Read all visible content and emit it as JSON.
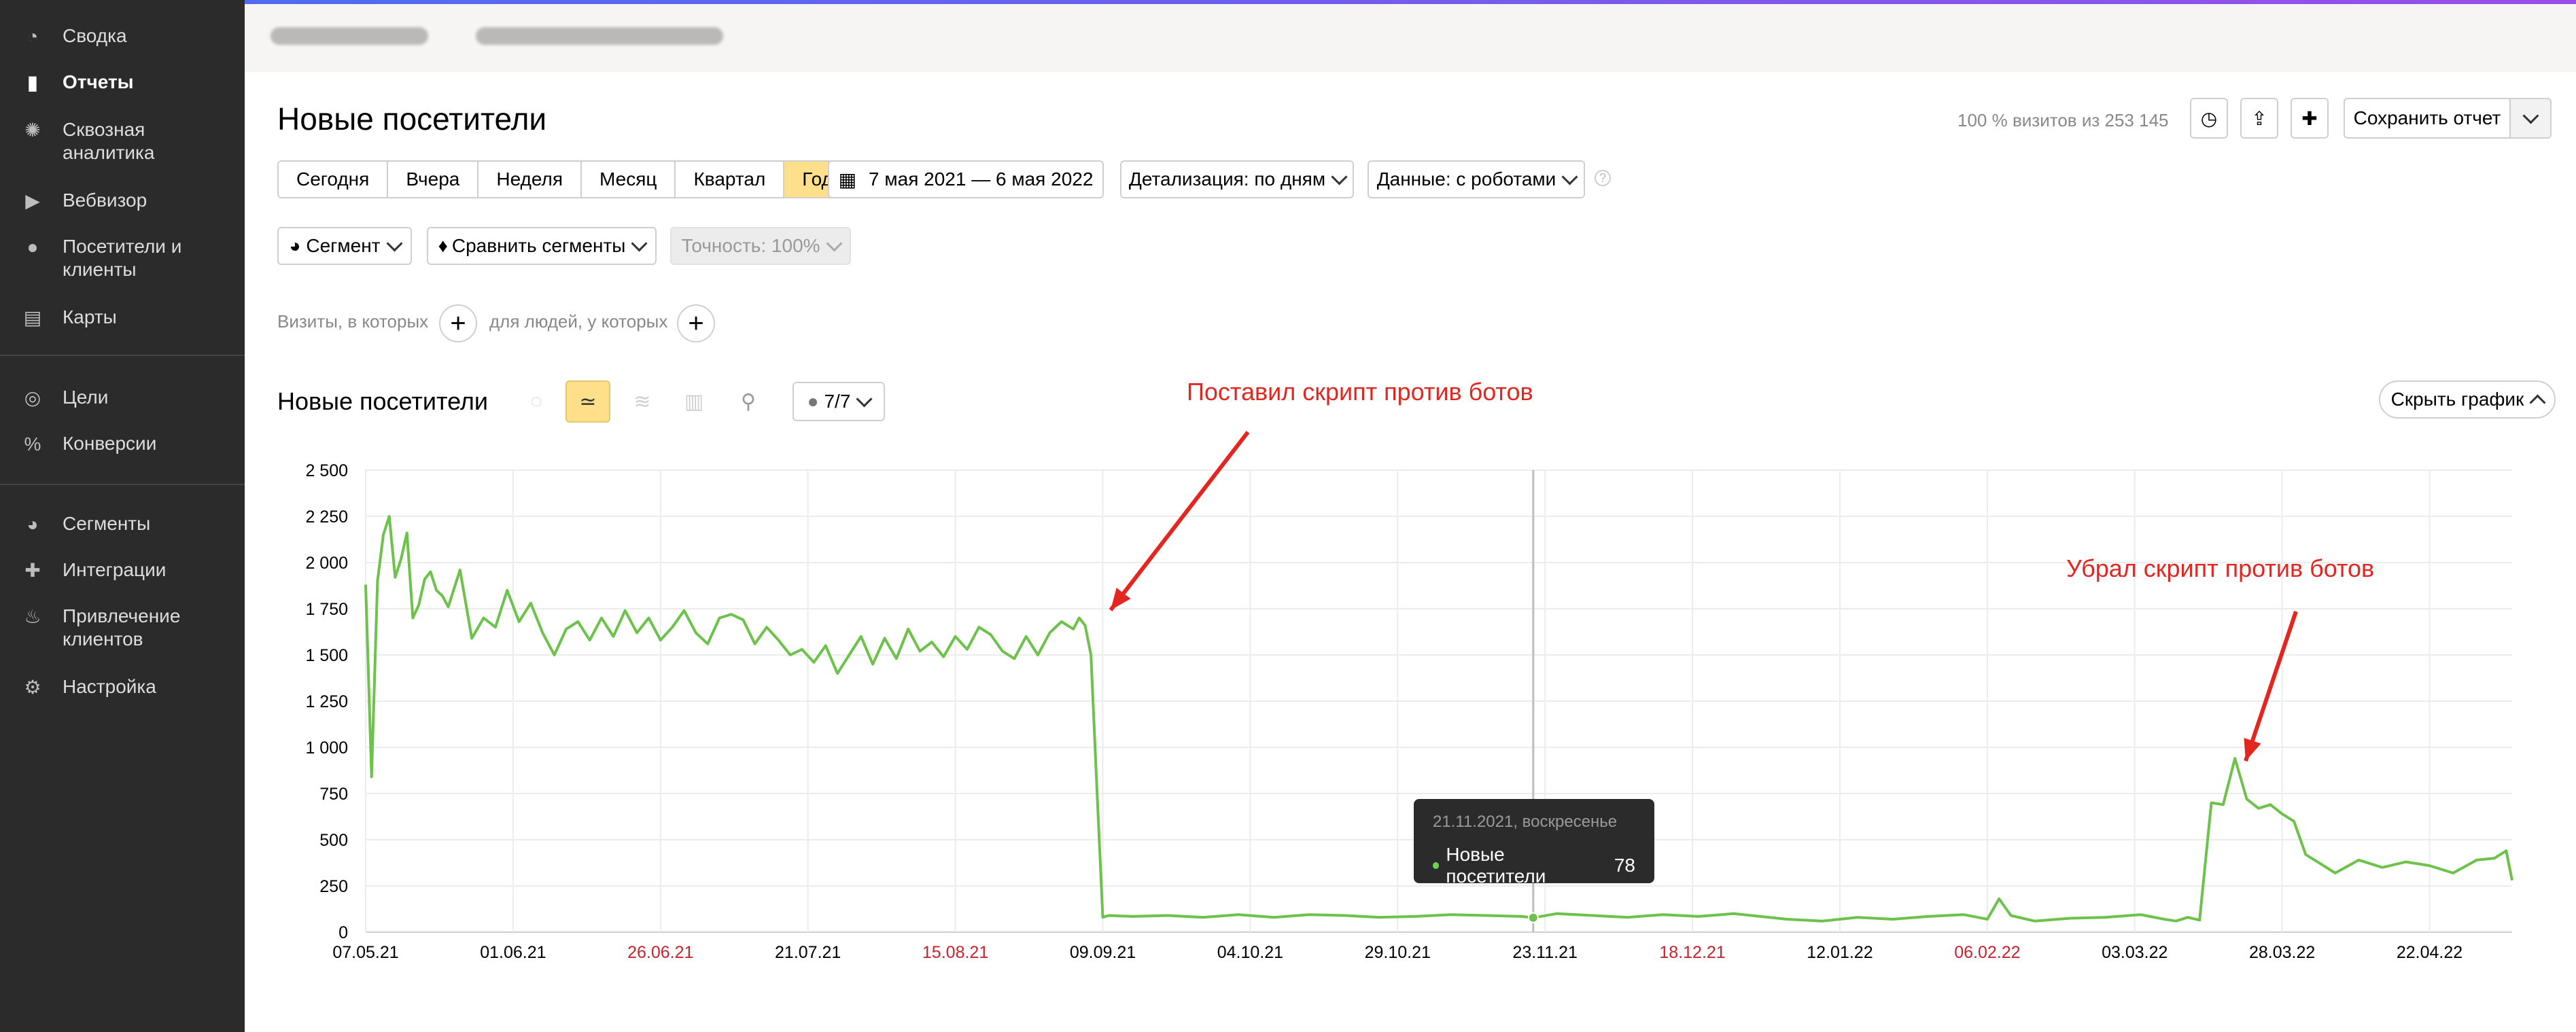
{
  "sidebar": {
    "items": [
      {
        "label": "Сводка",
        "icon": "dashboard-icon",
        "glyph": "◔"
      },
      {
        "label": "Отчеты",
        "icon": "bar-chart-icon",
        "glyph": "▮"
      },
      {
        "label": "Сквозная аналитика",
        "icon": "network-icon",
        "glyph": "✺"
      },
      {
        "label": "Вебвизор",
        "icon": "play-icon",
        "glyph": "▶"
      },
      {
        "label": "Посетители и клиенты",
        "icon": "person-icon",
        "glyph": "●"
      },
      {
        "label": "Карты",
        "icon": "map-icon",
        "glyph": "▤"
      },
      {
        "label": "Цели",
        "icon": "target-icon",
        "glyph": "◎"
      },
      {
        "label": "Конверсии",
        "icon": "percent-icon",
        "glyph": "%"
      },
      {
        "label": "Сегменты",
        "icon": "pie-icon",
        "glyph": "◕"
      },
      {
        "label": "Интеграции",
        "icon": "puzzle-icon",
        "glyph": "✚"
      },
      {
        "label": "Привлечение клиентов",
        "icon": "flame-icon",
        "glyph": "♨"
      },
      {
        "label": "Настройка",
        "icon": "gear-icon",
        "glyph": "⚙"
      }
    ]
  },
  "header": {
    "title": "Новые посетители",
    "summary": "100 % визитов из 253 145",
    "save_label": "Сохранить отчет"
  },
  "periods": [
    {
      "label": "Сегодня",
      "active": false
    },
    {
      "label": "Вчера",
      "active": false
    },
    {
      "label": "Неделя",
      "active": false
    },
    {
      "label": "Месяц",
      "active": false
    },
    {
      "label": "Квартал",
      "active": false
    },
    {
      "label": "Год",
      "active": true
    }
  ],
  "filters": {
    "date_range": "7 мая 2021 — 6 мая 2022",
    "detail": "Детализация: по дням",
    "data": "Данные: с роботами",
    "segment": "Сегмент",
    "compare": "Сравнить сегменты",
    "accuracy": "Точность: 100%",
    "visits_label": "Визиты, в которых",
    "people_label": "для людей, у которых"
  },
  "chart_header": {
    "title": "Новые посетители",
    "annotations_count": "7/7",
    "hide_label": "Скрыть график"
  },
  "annotations": {
    "first": "Поставил скрипт против ботов",
    "second": "Убрал скрипт против ботов"
  },
  "tooltip": {
    "date": "21.11.2021, воскресенье",
    "metric": "Новые посетители",
    "value": "78"
  },
  "chart_data": {
    "type": "line",
    "title": "",
    "xlabel": "",
    "ylabel": "",
    "ylim": [
      0,
      2500
    ],
    "yticks": [
      "2 500",
      "2 250",
      "2 000",
      "1 750",
      "1 500",
      "1 250",
      "1 000",
      "750",
      "500",
      "250",
      "0"
    ],
    "xticks": [
      {
        "label": "07.05.21",
        "day": 0,
        "holiday": false
      },
      {
        "label": "01.06.21",
        "day": 25,
        "holiday": false
      },
      {
        "label": "26.06.21",
        "day": 50,
        "holiday": true
      },
      {
        "label": "21.07.21",
        "day": 75,
        "holiday": false
      },
      {
        "label": "15.08.21",
        "day": 100,
        "holiday": true
      },
      {
        "label": "09.09.21",
        "day": 125,
        "holiday": false
      },
      {
        "label": "04.10.21",
        "day": 150,
        "holiday": false
      },
      {
        "label": "29.10.21",
        "day": 175,
        "holiday": false
      },
      {
        "label": "23.11.21",
        "day": 200,
        "holiday": false
      },
      {
        "label": "18.12.21",
        "day": 225,
        "holiday": true
      },
      {
        "label": "12.01.22",
        "day": 250,
        "holiday": false
      },
      {
        "label": "06.02.22",
        "day": 275,
        "holiday": true
      },
      {
        "label": "03.03.22",
        "day": 300,
        "holiday": false
      },
      {
        "label": "28.03.22",
        "day": 325,
        "holiday": false
      },
      {
        "label": "22.04.22",
        "day": 350,
        "holiday": false
      }
    ],
    "grid": true,
    "series": [
      {
        "name": "Новые посетители",
        "color": "#6cc24a",
        "x": [
          "2021-05-07",
          "2021-05-08",
          "2021-05-09",
          "2021-05-10",
          "2021-05-11",
          "2021-05-12",
          "2021-05-13",
          "2021-05-14",
          "2021-05-15",
          "2021-05-16",
          "2021-05-17",
          "2021-05-18",
          "2021-05-19",
          "2021-05-20",
          "2021-05-21",
          "2021-05-23",
          "2021-05-25",
          "2021-05-27",
          "2021-05-29",
          "2021-05-31",
          "2021-06-02",
          "2021-06-04",
          "2021-06-06",
          "2021-06-08",
          "2021-06-10",
          "2021-06-12",
          "2021-06-14",
          "2021-06-16",
          "2021-06-18",
          "2021-06-20",
          "2021-06-22",
          "2021-06-24",
          "2021-06-26",
          "2021-06-28",
          "2021-06-30",
          "2021-07-02",
          "2021-07-04",
          "2021-07-06",
          "2021-07-08",
          "2021-07-10",
          "2021-07-12",
          "2021-07-14",
          "2021-07-16",
          "2021-07-18",
          "2021-07-20",
          "2021-07-22",
          "2021-07-24",
          "2021-07-26",
          "2021-07-28",
          "2021-07-30",
          "2021-08-01",
          "2021-08-03",
          "2021-08-05",
          "2021-08-07",
          "2021-08-09",
          "2021-08-11",
          "2021-08-13",
          "2021-08-15",
          "2021-08-17",
          "2021-08-19",
          "2021-08-21",
          "2021-08-23",
          "2021-08-25",
          "2021-08-27",
          "2021-08-29",
          "2021-08-31",
          "2021-09-02",
          "2021-09-04",
          "2021-09-05",
          "2021-09-06",
          "2021-09-07",
          "2021-09-08",
          "2021-09-09",
          "2021-09-10",
          "2021-09-14",
          "2021-09-20",
          "2021-09-26",
          "2021-10-02",
          "2021-10-08",
          "2021-10-14",
          "2021-10-20",
          "2021-10-26",
          "2021-11-01",
          "2021-11-07",
          "2021-11-13",
          "2021-11-19",
          "2021-11-21",
          "2021-11-25",
          "2021-12-01",
          "2021-12-07",
          "2021-12-13",
          "2021-12-19",
          "2021-12-25",
          "2021-12-31",
          "2022-01-03",
          "2022-01-09",
          "2022-01-15",
          "2022-01-21",
          "2022-01-27",
          "2022-02-02",
          "2022-02-06",
          "2022-02-08",
          "2022-02-10",
          "2022-02-14",
          "2022-02-20",
          "2022-02-26",
          "2022-03-04",
          "2022-03-08",
          "2022-03-10",
          "2022-03-12",
          "2022-03-14",
          "2022-03-16",
          "2022-03-18",
          "2022-03-20",
          "2022-03-22",
          "2022-03-24",
          "2022-03-26",
          "2022-03-28",
          "2022-03-30",
          "2022-04-01",
          "2022-04-03",
          "2022-04-06",
          "2022-04-10",
          "2022-04-14",
          "2022-04-18",
          "2022-04-22",
          "2022-04-26",
          "2022-04-30",
          "2022-05-03",
          "2022-05-05",
          "2022-05-06"
        ],
        "values": [
          1880,
          840,
          1900,
          2150,
          2250,
          1920,
          2020,
          2160,
          1700,
          1770,
          1910,
          1950,
          1850,
          1820,
          1760,
          1960,
          1590,
          1700,
          1650,
          1850,
          1680,
          1780,
          1620,
          1500,
          1640,
          1680,
          1580,
          1700,
          1600,
          1740,
          1620,
          1700,
          1580,
          1650,
          1740,
          1620,
          1560,
          1700,
          1720,
          1690,
          1560,
          1650,
          1580,
          1500,
          1530,
          1460,
          1550,
          1400,
          1500,
          1600,
          1450,
          1590,
          1480,
          1640,
          1520,
          1570,
          1490,
          1600,
          1530,
          1650,
          1610,
          1520,
          1480,
          1600,
          1500,
          1620,
          1680,
          1640,
          1700,
          1660,
          1500,
          780,
          80,
          90,
          85,
          90,
          80,
          95,
          80,
          95,
          90,
          80,
          85,
          95,
          90,
          85,
          78,
          100,
          90,
          80,
          95,
          85,
          100,
          80,
          70,
          60,
          80,
          70,
          85,
          95,
          70,
          180,
          90,
          60,
          75,
          80,
          95,
          70,
          60,
          80,
          65,
          700,
          690,
          940,
          720,
          670,
          690,
          640,
          600,
          420,
          380,
          320,
          390,
          350,
          380,
          360,
          320,
          390,
          400,
          440,
          280
        ]
      }
    ]
  }
}
